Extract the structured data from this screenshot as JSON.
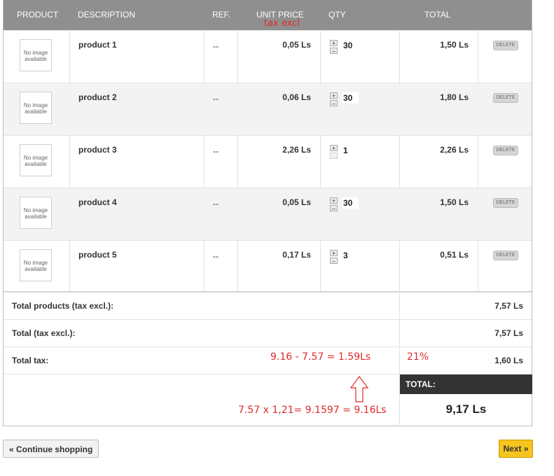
{
  "header": {
    "product": "PRODUCT",
    "description": "DESCRIPTION",
    "ref": "REF.",
    "unit_price": "UNIT PRICE",
    "qty": "QTY",
    "total": "TOTAL",
    "unit_price_note": "tax excl"
  },
  "products": [
    {
      "image_text": "No image available",
      "name": "product 1",
      "ref": "--",
      "unit_price": "0,05 Ls",
      "qty": "30",
      "total": "1,50 Ls",
      "delete": "DELETE",
      "minus_enabled": true
    },
    {
      "image_text": "No image available",
      "name": "product 2",
      "ref": "--",
      "unit_price": "0,06 Ls",
      "qty": "30",
      "total": "1,80 Ls",
      "delete": "DELETE",
      "minus_enabled": true
    },
    {
      "image_text": "No image available",
      "name": "product 3",
      "ref": "--",
      "unit_price": "2,26 Ls",
      "qty": "1",
      "total": "2,26 Ls",
      "delete": "DELETE",
      "minus_enabled": false
    },
    {
      "image_text": "No image available",
      "name": "product 4",
      "ref": "--",
      "unit_price": "0,05 Ls",
      "qty": "30",
      "total": "1,50 Ls",
      "delete": "DELETE",
      "minus_enabled": true
    },
    {
      "image_text": "No image available",
      "name": "product 5",
      "ref": "--",
      "unit_price": "0,17 Ls",
      "qty": "3",
      "total": "0,51 Ls",
      "delete": "DELETE",
      "minus_enabled": true
    }
  ],
  "summary": {
    "total_products_label": "Total products (tax excl.):",
    "total_products_value": "7,57 Ls",
    "total_label": "Total (tax excl.):",
    "total_value": "7,57 Ls",
    "tax_label": "Total tax:",
    "tax_value": "1,60 Ls",
    "grand_label": "TOTAL:",
    "grand_value": "9,17 Ls"
  },
  "annotations": {
    "tax_calc": "9.16 - 7.57 = 1.59Ls",
    "tax_rate": "21%",
    "total_calc": "7.57 x 1,21= 9.1597 = 9.16Ls"
  },
  "buttons": {
    "continue": "« Continue shopping",
    "next": "Next »"
  },
  "colors": {
    "header_bg": "#8f8f8f",
    "annotation": "#e02a2a",
    "grand_total_bg": "#333333",
    "next_button": "#f5c51e"
  }
}
